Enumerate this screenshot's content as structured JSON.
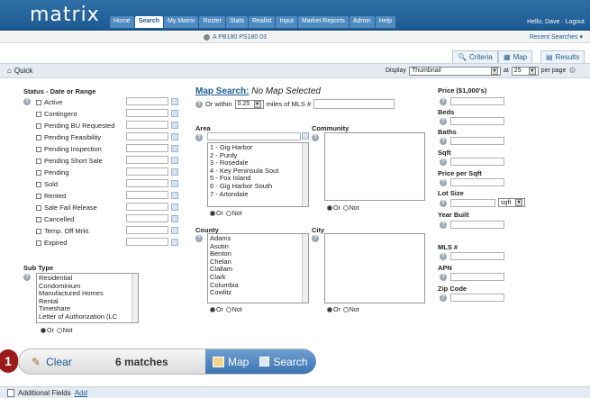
{
  "header": {
    "logo": "matrix",
    "greeting": "Hello, Dave · Logout",
    "nav": [
      "Home",
      "Search",
      "My Matrix",
      "Roster",
      "Stats",
      "Realist",
      "Input",
      "Market Reports",
      "Admin",
      "Help"
    ]
  },
  "recent": {
    "current": "A PB180 PS180 03",
    "recent_label": "Recent Searches"
  },
  "view_tabs": {
    "criteria": "Criteria",
    "map": "Map",
    "results": "Results"
  },
  "toolbar": {
    "quick": "Quick",
    "display_label": "Display",
    "display_value": "Thumbnail",
    "at_label": "at",
    "per_page_value": "25",
    "per_page_label": "per page"
  },
  "status": {
    "title": "Status - Date or Range",
    "items": [
      "Active",
      "Contingent",
      "Pending BU Requested",
      "Pending Feasibility",
      "Pending Inspection",
      "Pending Short Sale",
      "Pending",
      "Sold",
      "Rented",
      "Sale Fail Release",
      "Cancelled",
      "Temp. Off Mrkt.",
      "Expired"
    ]
  },
  "subtype": {
    "title": "Sub Type",
    "items": [
      "Residential",
      "Condominium",
      "Manufactured Homes",
      "Rental",
      "Timeshare",
      "Letter of Authorization (LC"
    ],
    "or": "Or",
    "not": "Not"
  },
  "map_search": {
    "link": "Map Search:",
    "status": "No Map Selected",
    "or_within": "Or within",
    "miles_value": "0.25",
    "miles_label": "miles of MLS #"
  },
  "area": {
    "title": "Area",
    "items": [
      "1 - Gig Harbor",
      "2 - Purdy",
      "3 - Rosedale",
      "4 - Key Peninsula Sout",
      "5 - Fox Island",
      "6 - Gig Harbor South",
      "7 - Artondale"
    ],
    "or": "Or",
    "not": "Not"
  },
  "community": {
    "title": "Community",
    "or": "Or",
    "not": "Not"
  },
  "county": {
    "title": "County",
    "items": [
      "Adams",
      "Asotin",
      "Benton",
      "Chelan",
      "Clallam",
      "Clark",
      "Columbia",
      "Cowlitz"
    ],
    "or": "Or",
    "not": "Not"
  },
  "city": {
    "title": "City",
    "or": "Or",
    "not": "Not"
  },
  "right": {
    "price": "Price ($1,000's)",
    "beds": "Beds",
    "baths": "Baths",
    "sqft": "Sqft",
    "price_sqft": "Price per Sqft",
    "lot": "Lot Size",
    "lot_unit": "sqft",
    "year": "Year Built",
    "mls": "MLS #",
    "apn": "APN",
    "zip": "Zip Code"
  },
  "actions": {
    "badge": "1",
    "clear": "Clear",
    "matches": "6 matches",
    "map": "Map",
    "search": "Search"
  },
  "footer": {
    "label": "Additional Fields",
    "add": "Add"
  }
}
